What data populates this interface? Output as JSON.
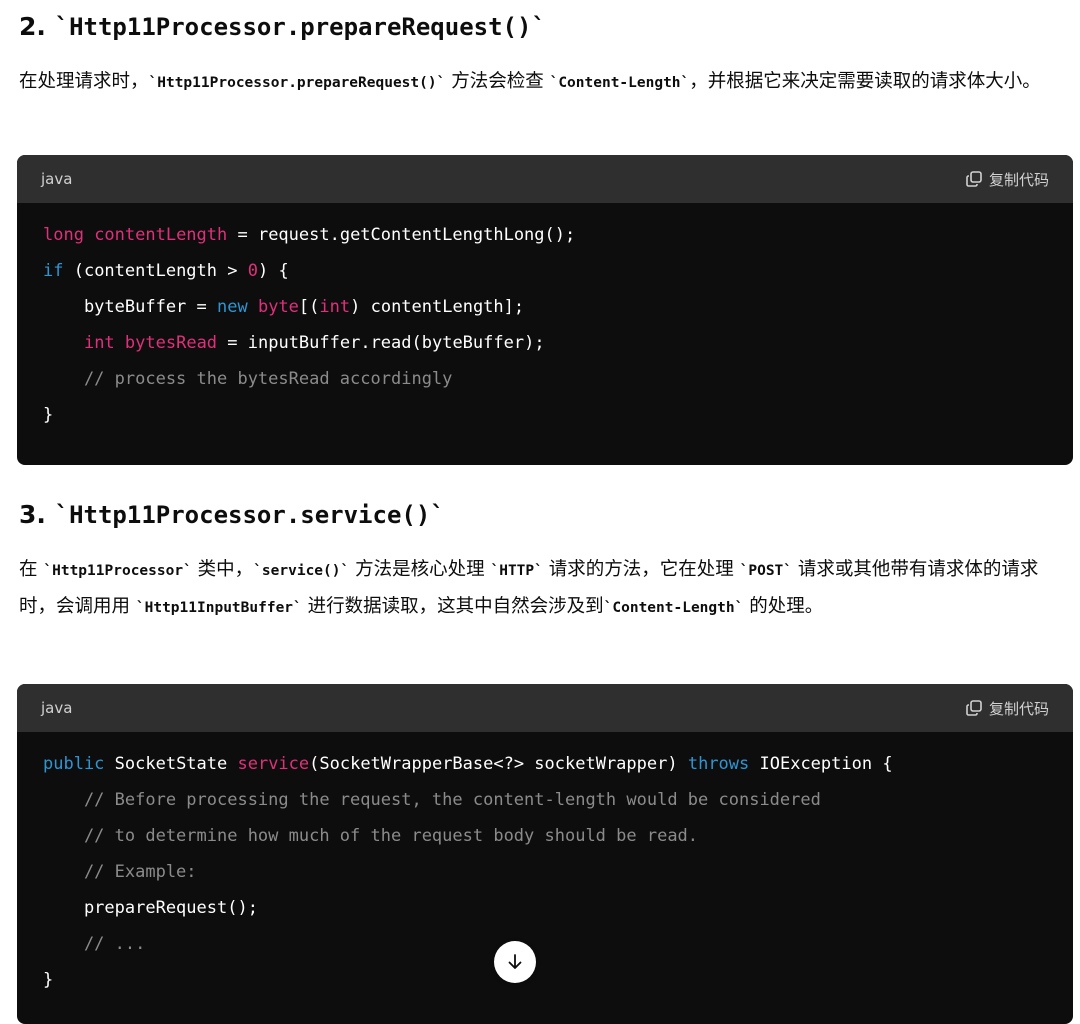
{
  "section2": {
    "number": "2.",
    "heading_code": "`Http11Processor.prepareRequest()`",
    "para_parts": [
      "在处理请求时，",
      "`Http11Processor.prepareRequest()`",
      " 方法会检查 ",
      "`Content-Length`",
      "，并根据它来决定需要读取的请求体大小。"
    ],
    "code_language": "java",
    "copy_label": "复制代码"
  },
  "section3": {
    "number": "3.",
    "heading_code": "`Http11Processor.service()`",
    "para_parts": [
      "在 ",
      "`Http11Processor`",
      " 类中，",
      "`service()`",
      " 方法是核心处理 ",
      "`HTTP`",
      " 请求的方法，它在处理 ",
      "`POST`",
      " 请求或其他带有请求体的请求时，会调用用 ",
      "`Http11InputBuffer`",
      " 进行数据读取，这其中自然会涉及到",
      "`Content-Length`",
      " 的处理。"
    ],
    "code_language": "java",
    "copy_label": "复制代码"
  },
  "code1": [
    [
      [
        "long ",
        "kw-r"
      ],
      [
        "contentLength",
        "kw-r"
      ],
      [
        " = request.getContentLengthLong();",
        ""
      ]
    ],
    [
      [
        "if",
        "kw-b"
      ],
      [
        " (contentLength > ",
        ""
      ],
      [
        "0",
        "kw-r"
      ],
      [
        ") {",
        ""
      ]
    ],
    [
      [
        "    byteBuffer = ",
        ""
      ],
      [
        "new",
        "kw-b"
      ],
      [
        " ",
        ""
      ],
      [
        "byte",
        "kw-r"
      ],
      [
        "[(",
        ""
      ],
      [
        "int",
        "kw-r"
      ],
      [
        ") contentLength];",
        ""
      ]
    ],
    [
      [
        "    ",
        ""
      ],
      [
        "int",
        "kw-r"
      ],
      [
        " ",
        ""
      ],
      [
        "bytesRead",
        "kw-r"
      ],
      [
        " = inputBuffer.read(byteBuffer);",
        ""
      ]
    ],
    [
      [
        "    // process the bytesRead accordingly",
        "cm"
      ]
    ],
    [
      [
        "}",
        ""
      ]
    ]
  ],
  "code2": [
    [
      [
        "public",
        "kw-b"
      ],
      [
        " SocketState ",
        ""
      ],
      [
        "service",
        "kw-r"
      ],
      [
        "(SocketWrapperBase<?> socketWrapper) ",
        ""
      ],
      [
        "throws",
        "kw-b"
      ],
      [
        " IOException {",
        ""
      ]
    ],
    [
      [
        "    // Before processing the request, the content-length would be considered",
        "cm"
      ]
    ],
    [
      [
        "    // to determine how much of the request body should be read.",
        "cm"
      ]
    ],
    [
      [
        "    // Example:",
        "cm"
      ]
    ],
    [
      [
        "    prepareRequest();",
        ""
      ]
    ],
    [
      [
        "    // ...",
        "cm"
      ]
    ],
    [
      [
        "}",
        ""
      ]
    ]
  ],
  "icons": {
    "copy": "copy-icon",
    "scroll": "arrow-down-icon"
  }
}
